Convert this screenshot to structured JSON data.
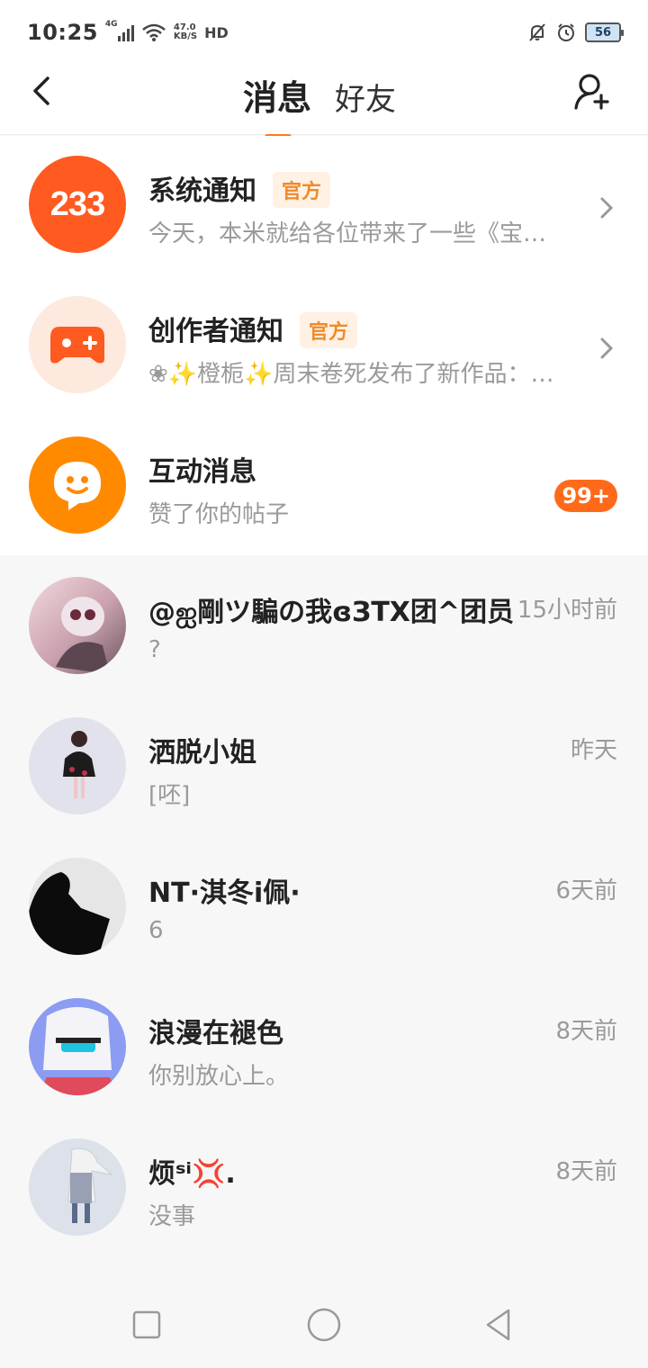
{
  "status_bar": {
    "time": "10:25",
    "network": "4G",
    "speed_value": "47.0",
    "speed_unit": "KB/S",
    "hd": "HD",
    "battery": "56"
  },
  "header": {
    "tab_messages": "消息",
    "tab_friends": "好友"
  },
  "notifications": [
    {
      "title": "系统通知",
      "badge": "官方",
      "preview": "今天，本米就给各位带来了一些《宝…",
      "avatar_label": "233",
      "avatar_color": "#ff5a1f"
    },
    {
      "title": "创作者通知",
      "badge": "官方",
      "preview": "❀✨橙栀✨周末卷死发布了新作品：…",
      "avatar_color": "#fde9dd"
    },
    {
      "title": "互动消息",
      "preview": "赞了你的帖子",
      "unread": "99+",
      "avatar_color": "#ff8a00"
    }
  ],
  "chats": [
    {
      "name": "@ஐ剛ツ騙の我ɞЗTX团^团员",
      "preview": "?",
      "time": "15小时前"
    },
    {
      "name": "洒脱小姐",
      "preview": "[呸]",
      "time": "昨天"
    },
    {
      "name": "NT·淇冬i佩·",
      "preview": "6",
      "time": "6天前"
    },
    {
      "name": "浪漫在褪色",
      "preview": "你别放心上。",
      "time": "8天前"
    },
    {
      "name": "烦ˢⁱ💢.",
      "preview": "没事",
      "time": "8天前"
    }
  ],
  "colors": {
    "accent": "#ff7a1a",
    "official_badge_text": "#f08a2a",
    "official_badge_bg": "#fff1e3"
  }
}
